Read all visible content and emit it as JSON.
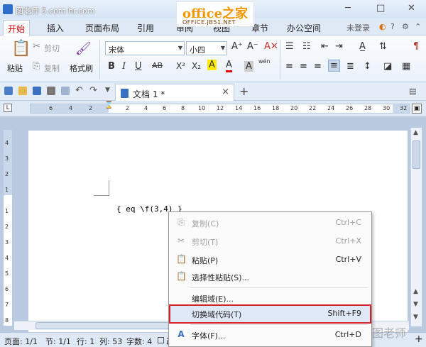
{
  "titlebar": {
    "title": "图老师 5.com  hr.com",
    "controls": [
      "─",
      "□",
      "✕"
    ]
  },
  "watermark": {
    "office": "office之家",
    "url": "OFFICE.JB51.NET"
  },
  "menu": {
    "tabs": [
      "开始",
      "插入",
      "页面布局",
      "引用",
      "审阅",
      "视图",
      "章节",
      "办公空间"
    ],
    "login": "未登录",
    "icons": [
      "skin-icon",
      "help-icon",
      "settings-icon",
      "collapse-icon"
    ]
  },
  "ribbon": {
    "paste": "粘贴",
    "cut": "剪切",
    "copy": "复制",
    "format_painter": "格式刷",
    "font_name": "宋体",
    "font_size": "小四",
    "bold": "B",
    "italic": "I",
    "underline": "U",
    "strike": "AB",
    "superscript": "X²",
    "subscript": "X₂",
    "highlight": "A",
    "font_color": "A",
    "char_shading": "A",
    "phonetic": "wén"
  },
  "doc_tab": {
    "label": "文档 1 *"
  },
  "ruler": {
    "numbers": [
      "6",
      "4",
      "2",
      "2",
      "4",
      "6",
      "8",
      "10",
      "12",
      "14",
      "16",
      "18",
      "20",
      "22",
      "24",
      "26",
      "28",
      "30",
      "32"
    ]
  },
  "vruler": {
    "numbers": [
      "4",
      "3",
      "2",
      "1",
      "1",
      "2",
      "3",
      "4",
      "5",
      "6",
      "7",
      "8"
    ]
  },
  "document": {
    "field_code": "{ eq \\f(3,4) }"
  },
  "context_menu": {
    "items": [
      {
        "label": "复制(C)",
        "shortcut": "Ctrl+C",
        "icon": "copy-icon",
        "disabled": true
      },
      {
        "label": "剪切(T)",
        "shortcut": "Ctrl+X",
        "icon": "scissors-icon",
        "disabled": true
      },
      {
        "label": "粘贴(P)",
        "shortcut": "Ctrl+V",
        "icon": "paste-icon",
        "disabled": false
      },
      {
        "label": "选择性粘贴(S)...",
        "shortcut": "",
        "icon": "paste-special-icon",
        "disabled": false
      },
      {
        "label": "编辑域(E)...",
        "shortcut": "",
        "icon": "",
        "disabled": false
      },
      {
        "label": "切换域代码(T)",
        "shortcut": "Shift+F9",
        "icon": "",
        "disabled": false,
        "highlighted": true
      },
      {
        "label": "字体(F)...",
        "shortcut": "Ctrl+D",
        "icon": "font-icon",
        "disabled": false
      }
    ]
  },
  "statusbar": {
    "page": "页面: 1/1",
    "section": "节: 1/1",
    "row": "行: 1",
    "col": "列: 53",
    "words": "字数: 4",
    "mode": "改"
  },
  "watermark2": "图老师",
  "colors": {
    "accent": "#d21f2a",
    "ribbon_bg": "#eaf1fa",
    "workspace": "#b8c9e0"
  }
}
